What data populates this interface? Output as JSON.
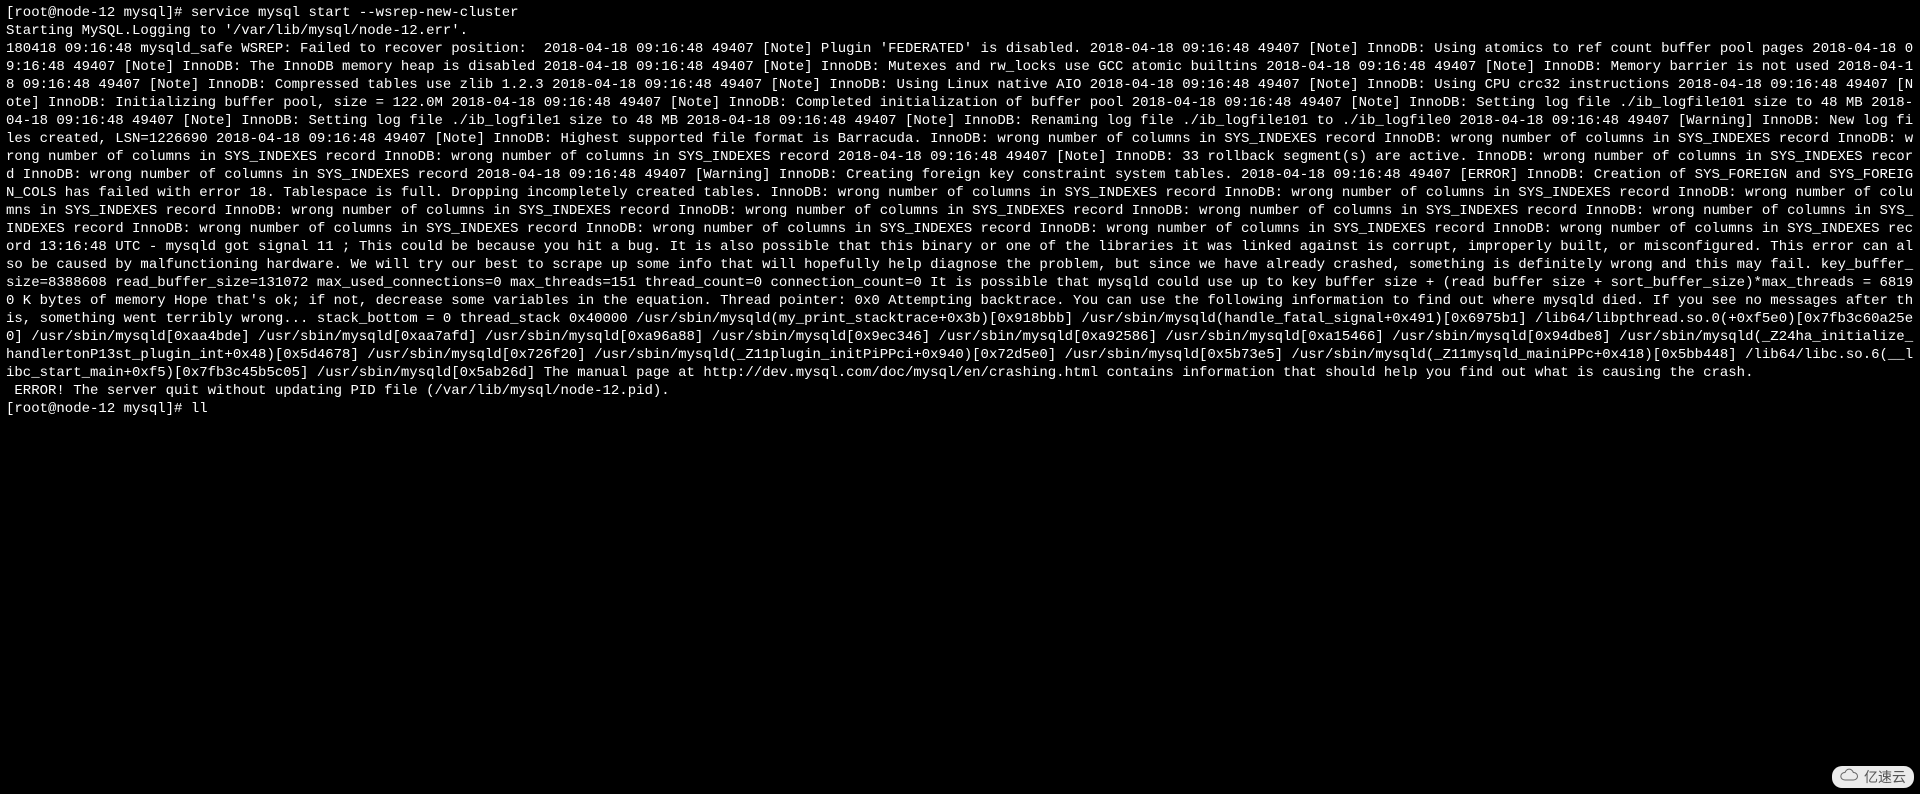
{
  "terminal": {
    "prompt1": "[root@node-12 mysql]# ",
    "command1": "service mysql start --wsrep-new-cluster",
    "line_starting": "Starting MySQL.Logging to '/var/lib/mysql/node-12.err'.",
    "body": "180418 09:16:48 mysqld_safe WSREP: Failed to recover position:  2018-04-18 09:16:48 49407 [Note] Plugin 'FEDERATED' is disabled. 2018-04-18 09:16:48 49407 [Note] InnoDB: Using atomics to ref count buffer pool pages 2018-04-18 09:16:48 49407 [Note] InnoDB: The InnoDB memory heap is disabled 2018-04-18 09:16:48 49407 [Note] InnoDB: Mutexes and rw_locks use GCC atomic builtins 2018-04-18 09:16:48 49407 [Note] InnoDB: Memory barrier is not used 2018-04-18 09:16:48 49407 [Note] InnoDB: Compressed tables use zlib 1.2.3 2018-04-18 09:16:48 49407 [Note] InnoDB: Using Linux native AIO 2018-04-18 09:16:48 49407 [Note] InnoDB: Using CPU crc32 instructions 2018-04-18 09:16:48 49407 [Note] InnoDB: Initializing buffer pool, size = 122.0M 2018-04-18 09:16:48 49407 [Note] InnoDB: Completed initialization of buffer pool 2018-04-18 09:16:48 49407 [Note] InnoDB: Setting log file ./ib_logfile101 size to 48 MB 2018-04-18 09:16:48 49407 [Note] InnoDB: Setting log file ./ib_logfile1 size to 48 MB 2018-04-18 09:16:48 49407 [Note] InnoDB: Renaming log file ./ib_logfile101 to ./ib_logfile0 2018-04-18 09:16:48 49407 [Warning] InnoDB: New log files created, LSN=1226690 2018-04-18 09:16:48 49407 [Note] InnoDB: Highest supported file format is Barracuda. InnoDB: wrong number of columns in SYS_INDEXES record InnoDB: wrong number of columns in SYS_INDEXES record InnoDB: wrong number of columns in SYS_INDEXES record InnoDB: wrong number of columns in SYS_INDEXES record 2018-04-18 09:16:48 49407 [Note] InnoDB: 33 rollback segment(s) are active. InnoDB: wrong number of columns in SYS_INDEXES record InnoDB: wrong number of columns in SYS_INDEXES record 2018-04-18 09:16:48 49407 [Warning] InnoDB: Creating foreign key constraint system tables. 2018-04-18 09:16:48 49407 [ERROR] InnoDB: Creation of SYS_FOREIGN and SYS_FOREIGN_COLS has failed with error 18. Tablespace is full. Dropping incompletely created tables. InnoDB: wrong number of columns in SYS_INDEXES record InnoDB: wrong number of columns in SYS_INDEXES record InnoDB: wrong number of columns in SYS_INDEXES record InnoDB: wrong number of columns in SYS_INDEXES record InnoDB: wrong number of columns in SYS_INDEXES record InnoDB: wrong number of columns in SYS_INDEXES record InnoDB: wrong number of columns in SYS_INDEXES record InnoDB: wrong number of columns in SYS_INDEXES record InnoDB: wrong number of columns in SYS_INDEXES record InnoDB: wrong number of columns in SYS_INDEXES record InnoDB: wrong number of columns in SYS_INDEXES record 13:16:48 UTC - mysqld got signal 11 ; This could be because you hit a bug. It is also possible that this binary or one of the libraries it was linked against is corrupt, improperly built, or misconfigured. This error can also be caused by malfunctioning hardware. We will try our best to scrape up some info that will hopefully help diagnose the problem, but since we have already crashed, something is definitely wrong and this may fail. key_buffer_size=8388608 read_buffer_size=131072 max_used_connections=0 max_threads=151 thread_count=0 connection_count=0 It is possible that mysqld could use up to key buffer size + (read buffer size + sort_buffer_size)*max_threads = 68190 K bytes of memory Hope that's ok; if not, decrease some variables in the equation. Thread pointer: 0x0 Attempting backtrace. You can use the following information to find out where mysqld died. If you see no messages after this, something went terribly wrong... stack_bottom = 0 thread_stack 0x40000 /usr/sbin/mysqld(my_print_stacktrace+0x3b)[0x918bbb] /usr/sbin/mysqld(handle_fatal_signal+0x491)[0x6975b1] /lib64/libpthread.so.0(+0xf5e0)[0x7fb3c60a25e0] /usr/sbin/mysqld[0xaa4bde] /usr/sbin/mysqld[0xaa7afd] /usr/sbin/mysqld[0xa96a88] /usr/sbin/mysqld[0x9ec346] /usr/sbin/mysqld[0xa92586] /usr/sbin/mysqld[0xa15466] /usr/sbin/mysqld[0x94dbe8] /usr/sbin/mysqld(_Z24ha_initialize_handlertonP13st_plugin_int+0x48)[0x5d4678] /usr/sbin/mysqld[0x726f20] /usr/sbin/mysqld(_Z11plugin_initPiPPci+0x940)[0x72d5e0] /usr/sbin/mysqld[0x5b73e5] /usr/sbin/mysqld(_Z11mysqld_mainiPPc+0x418)[0x5bb448] /lib64/libc.so.6(__libc_start_main+0xf5)[0x7fb3c45b5c05] /usr/sbin/mysqld[0x5ab26d] The manual page at http://dev.mysql.com/doc/mysql/en/crashing.html contains information that should help you find out what is causing the crash.",
    "line_error": " ERROR! The server quit without updating PID file (/var/lib/mysql/node-12.pid).",
    "prompt2": "[root@node-12 mysql]# ",
    "command2": "ll"
  },
  "watermark": {
    "text": "亿速云"
  }
}
